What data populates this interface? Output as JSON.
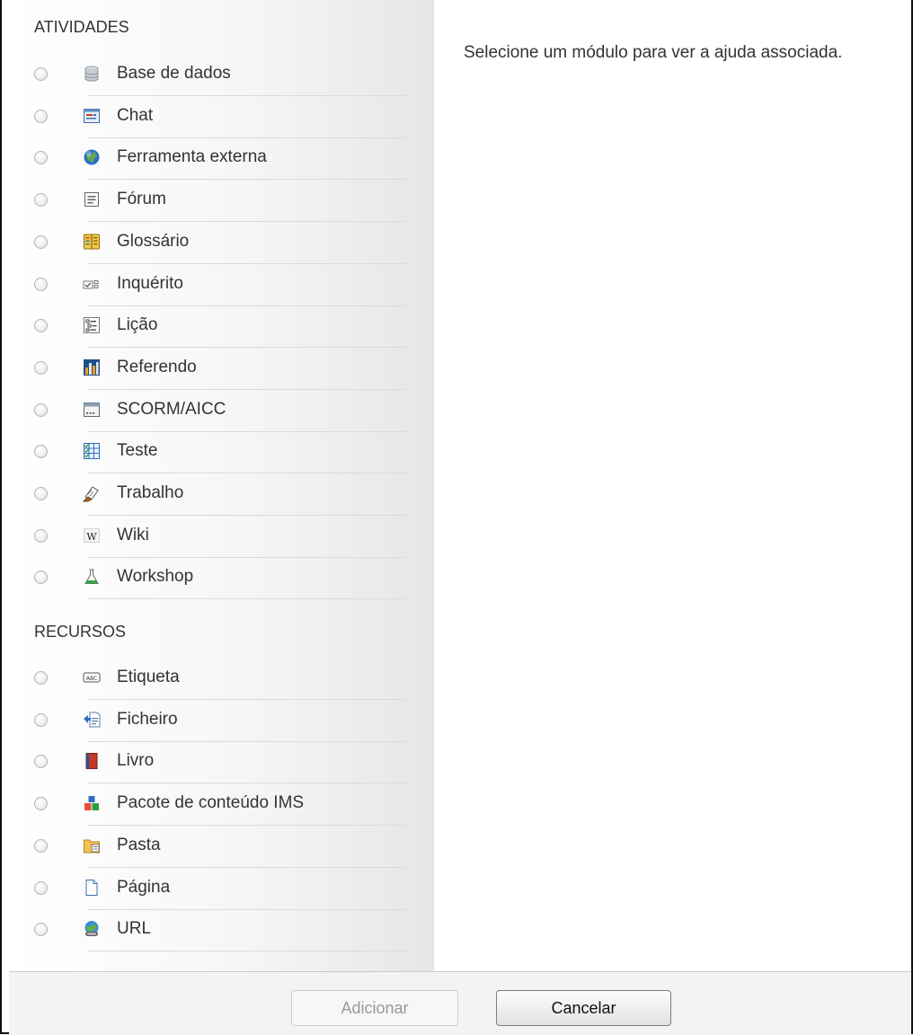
{
  "help_text": "Selecione um módulo para ver a ajuda associada.",
  "sections": {
    "activities": {
      "title": "ATIVIDADES",
      "items": [
        {
          "label": "Base de dados",
          "icon": "database-icon"
        },
        {
          "label": "Chat",
          "icon": "chat-icon"
        },
        {
          "label": "Ferramenta externa",
          "icon": "globe-icon"
        },
        {
          "label": "Fórum",
          "icon": "forum-icon"
        },
        {
          "label": "Glossário",
          "icon": "glossary-icon"
        },
        {
          "label": "Inquérito",
          "icon": "survey-icon"
        },
        {
          "label": "Lição",
          "icon": "lesson-icon"
        },
        {
          "label": "Referendo",
          "icon": "bar-chart-icon"
        },
        {
          "label": "SCORM/AICC",
          "icon": "scorm-icon"
        },
        {
          "label": "Teste",
          "icon": "quiz-icon"
        },
        {
          "label": "Trabalho",
          "icon": "assignment-icon"
        },
        {
          "label": "Wiki",
          "icon": "wiki-icon"
        },
        {
          "label": "Workshop",
          "icon": "flask-icon"
        }
      ]
    },
    "resources": {
      "title": "RECURSOS",
      "items": [
        {
          "label": "Etiqueta",
          "icon": "label-icon"
        },
        {
          "label": "Ficheiro",
          "icon": "file-icon"
        },
        {
          "label": "Livro",
          "icon": "book-icon"
        },
        {
          "label": "Pacote de conteúdo IMS",
          "icon": "ims-package-icon"
        },
        {
          "label": "Pasta",
          "icon": "folder-icon"
        },
        {
          "label": "Página",
          "icon": "page-icon"
        },
        {
          "label": "URL",
          "icon": "url-icon"
        }
      ]
    }
  },
  "buttons": {
    "add": "Adicionar",
    "cancel": "Cancelar"
  }
}
